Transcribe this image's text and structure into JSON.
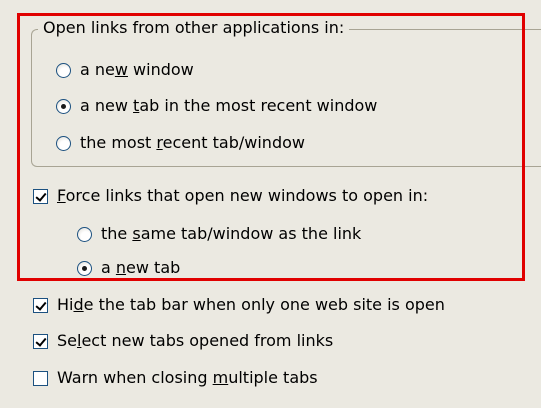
{
  "open_links_group": {
    "legend": "Open links from other applications in:",
    "options": [
      {
        "before": "a ne",
        "accel": "w",
        "after": " window",
        "selected": false
      },
      {
        "before": "a new ",
        "accel": "t",
        "after": "ab in the most recent window",
        "selected": true
      },
      {
        "before": "the most ",
        "accel": "r",
        "after": "ecent tab/window",
        "selected": false
      }
    ]
  },
  "force_links": {
    "checked": true,
    "before": "",
    "accel": "F",
    "after": "orce links that open new windows to open in:",
    "options": [
      {
        "before": "the ",
        "accel": "s",
        "after": "ame tab/window as the link",
        "selected": false
      },
      {
        "before": "a ",
        "accel": "n",
        "after": "ew tab",
        "selected": true
      }
    ]
  },
  "checkboxes": [
    {
      "before": "Hi",
      "accel": "d",
      "after": "e the tab bar when only one web site is open",
      "checked": true
    },
    {
      "before": "Se",
      "accel": "l",
      "after": "ect new tabs opened from links",
      "checked": true
    },
    {
      "before": "Warn when closing ",
      "accel": "m",
      "after": "ultiple tabs",
      "checked": false
    }
  ],
  "highlight_color": "#e00000"
}
